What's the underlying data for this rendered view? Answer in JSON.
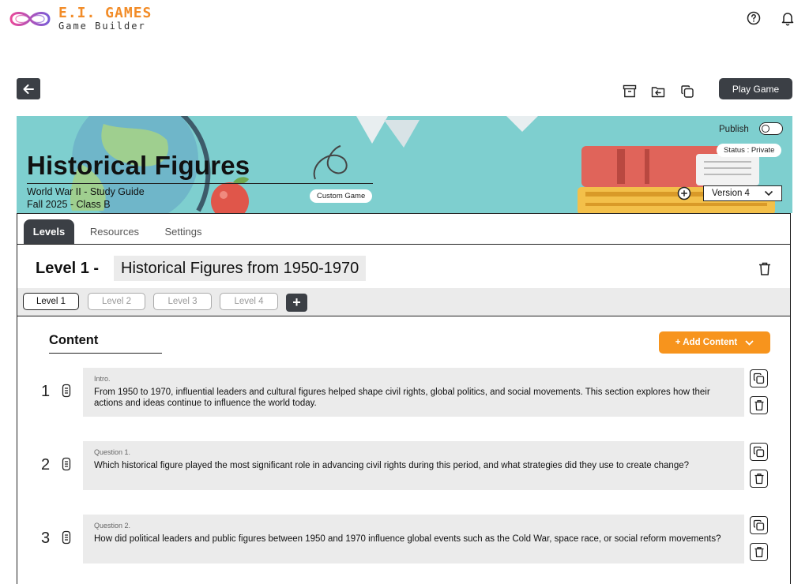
{
  "header": {
    "brand": "E.I. GAMES",
    "subtitle": "Game Builder",
    "help_icon": "help-circle-icon",
    "notification_icon": "bell-icon"
  },
  "toolbar": {
    "back_icon": "arrow-left-icon",
    "archive_icon": "archive-icon",
    "import_icon": "folder-import-icon",
    "copy_icon": "copy-icon",
    "play_label": "Play Game"
  },
  "banner": {
    "title": "Historical Figures",
    "subtitle1": "World War II - Study Guide",
    "subtitle2": "Fall 2025 - Class B",
    "custom_game_label": "Custom Game",
    "publish_label": "Publish",
    "publish_on": false,
    "status_label": "Status : Private",
    "version_label": "Version 4"
  },
  "tabs": [
    {
      "label": "Levels",
      "active": true
    },
    {
      "label": "Resources",
      "active": false
    },
    {
      "label": "Settings",
      "active": false
    }
  ],
  "level": {
    "label": "Level 1 -",
    "name": "Historical Figures from 1950-1970",
    "pills": [
      "Level 1",
      "Level 2",
      "Level 3",
      "Level 4"
    ],
    "add_label": "+"
  },
  "content": {
    "title": "Content",
    "add_button": "+ Add Content",
    "items": [
      {
        "number": "1",
        "label": "Intro.",
        "text": "From 1950 to 1970, influential leaders and cultural figures helped shape civil rights, global politics, and social movements. This section explores how their actions and ideas continue to influence the world today."
      },
      {
        "number": "2",
        "label": "Question 1.",
        "text": "Which historical figure played the most significant role in advancing civil rights during this period, and what strategies did they use to create change?"
      },
      {
        "number": "3",
        "label": "Question 2.",
        "text": "How did political leaders and public figures between 1950 and 1970 influence global events such as the Cold War, space race, or social reform movements?"
      }
    ]
  },
  "colors": {
    "accent": "#f7941d",
    "dark": "#3b3f45",
    "banner": "#7ecfcf",
    "logo_pink": "#e8499a",
    "logo_purple": "#7b5cd6"
  }
}
